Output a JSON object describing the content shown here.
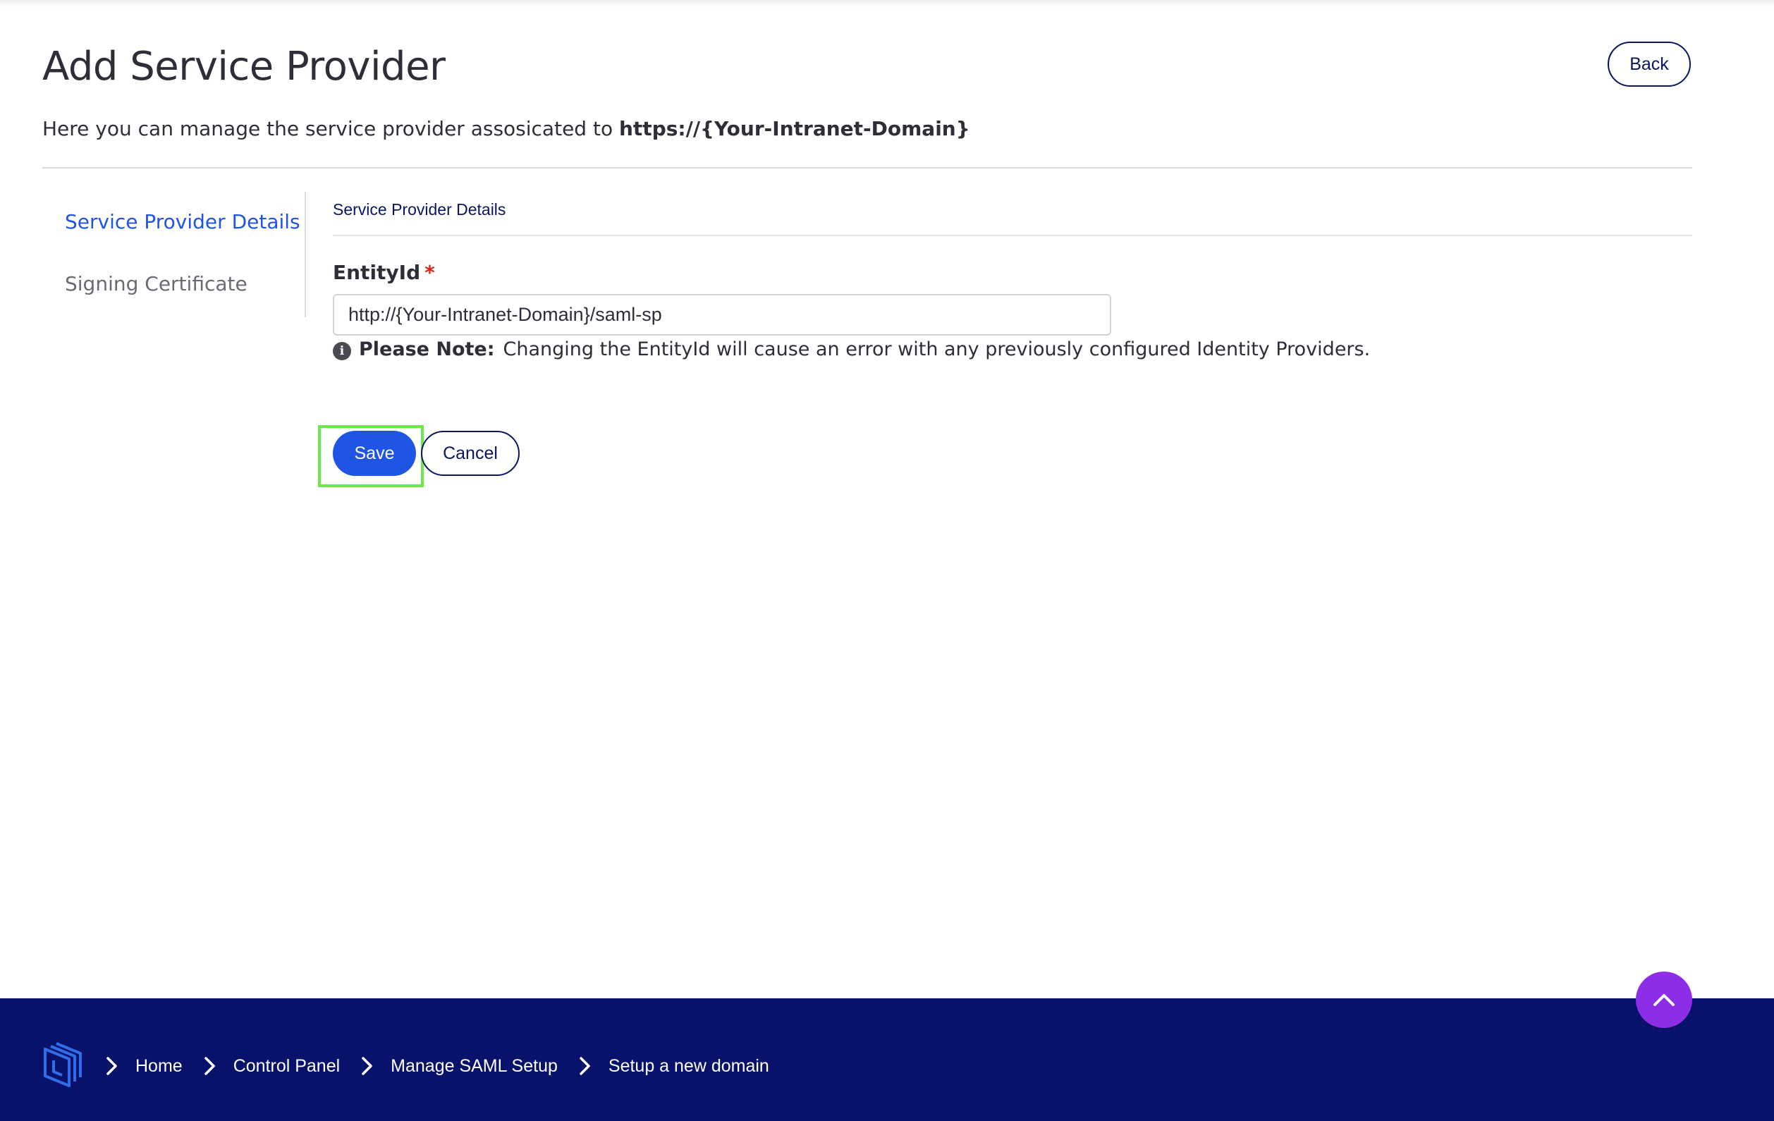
{
  "header": {
    "title": "Add Service Provider",
    "back_label": "Back",
    "subtitle_prefix": "Here you can manage the service provider assosicated to",
    "subtitle_domain": "https://{Your-Intranet-Domain}"
  },
  "sidenav": {
    "items": [
      {
        "label": "Service Provider Details",
        "active": true
      },
      {
        "label": "Signing Certificate",
        "active": false
      }
    ]
  },
  "form": {
    "section_title": "Service Provider Details",
    "entity_id": {
      "label": "EntityId",
      "required_marker": "*",
      "value": "http://{Your-Intranet-Domain}/saml-sp"
    },
    "note": {
      "label": "Please Note:",
      "text": "Changing the EntityId will cause an error with any previously configured Identity Providers."
    },
    "save_label": "Save",
    "cancel_label": "Cancel"
  },
  "footer": {
    "breadcrumbs": [
      "Home",
      "Control Panel",
      "Manage SAML Setup",
      "Setup a new domain"
    ]
  },
  "icons": {
    "info": "info-icon",
    "scroll_top": "chevron-up-icon",
    "breadcrumb_separator": "chevron-right-icon",
    "logo": "logo-icon"
  },
  "colors": {
    "accent": "#1f55e5",
    "navy": "#08126a",
    "scroll_button": "#8b2ee6",
    "highlight": "#6de84a",
    "required": "#d9241c"
  }
}
